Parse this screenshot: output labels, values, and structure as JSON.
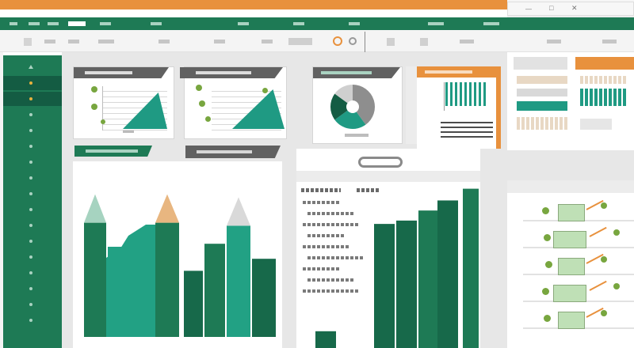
{
  "window": {
    "controls": {
      "minimize": "—",
      "maximize": "□",
      "close": "✕"
    }
  },
  "colors": {
    "brand_green": "#1e7a55",
    "dark_green": "#17694a",
    "teal": "#1f9a83",
    "orange": "#e8913d",
    "gray": "#9a9a9a"
  },
  "sidebar": {
    "items": [
      {
        "icon": "up-arrow-icon"
      },
      {
        "icon": "dot-icon",
        "active": true
      },
      {
        "icon": "dot-icon",
        "active": true
      },
      {
        "icon": "dot-icon"
      },
      {
        "icon": "dot-icon"
      },
      {
        "icon": "dot-icon"
      },
      {
        "icon": "dot-icon"
      },
      {
        "icon": "dot-icon"
      },
      {
        "icon": "dot-icon"
      },
      {
        "icon": "dot-icon"
      },
      {
        "icon": "dot-icon"
      },
      {
        "icon": "dot-icon"
      },
      {
        "icon": "dot-icon"
      },
      {
        "icon": "dot-icon"
      },
      {
        "icon": "dot-icon"
      },
      {
        "icon": "dot-icon"
      },
      {
        "icon": "dot-icon"
      }
    ]
  },
  "charts": {
    "big_bars": [
      {
        "h": 0.76,
        "color": "#1e7a55",
        "cap": "#a6d3c0"
      },
      {
        "h": 0.6,
        "color": "#22a184",
        "cap": ""
      },
      {
        "h": 0.76,
        "color": "#1e7a55",
        "cap": "#e8b680"
      },
      {
        "h": 0.44,
        "color": "#17694a",
        "cap": ""
      },
      {
        "h": 0.62,
        "color": "#1e7a55",
        "cap": ""
      },
      {
        "h": 0.74,
        "color": "#22a184",
        "cap": "#d9d9d9"
      },
      {
        "h": 0.52,
        "color": "#17694a",
        "cap": ""
      }
    ],
    "right_bars": [
      0.1,
      0.0,
      0.74,
      0.76,
      0.82,
      0.88,
      0.95
    ],
    "pie": [
      {
        "value": 40,
        "color": "#8e8e8e"
      },
      {
        "value": 25,
        "color": "#1f9a83"
      },
      {
        "value": 20,
        "color": "#145c43"
      },
      {
        "value": 15,
        "color": "#cfcfcf"
      }
    ]
  }
}
